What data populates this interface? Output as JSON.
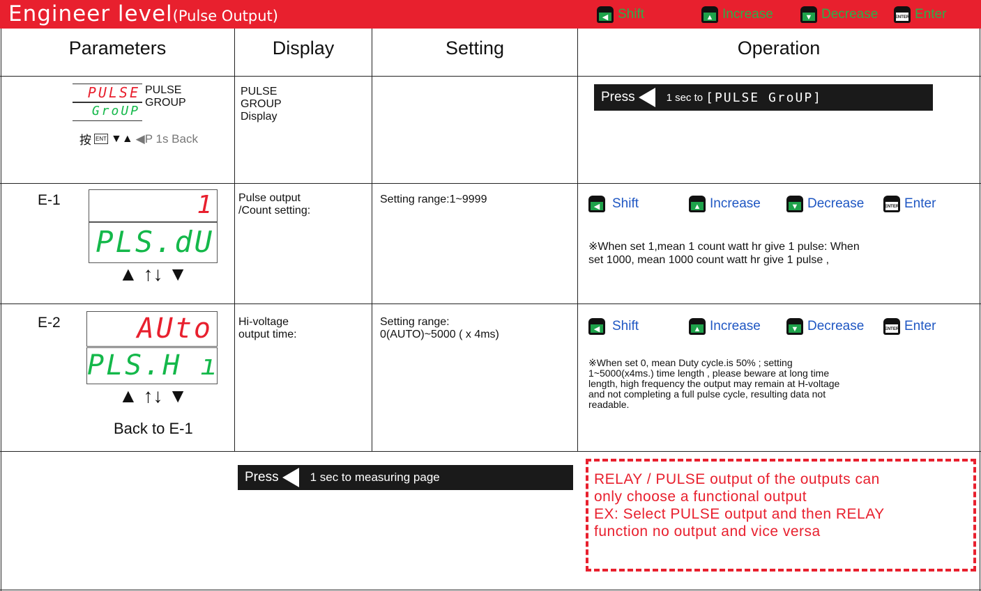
{
  "header": {
    "title": "Engineer level",
    "subtitle": "(Pulse Output)",
    "legend": [
      {
        "icon": "shift-key-icon",
        "label": "Shift",
        "glyph": "◀"
      },
      {
        "icon": "increase-key-icon",
        "label": "Increase",
        "glyph": "▲"
      },
      {
        "icon": "decrease-key-icon",
        "label": "Decrease",
        "glyph": "▼"
      },
      {
        "icon": "enter-key-icon",
        "label": "Enter",
        "glyph": "ENTER"
      }
    ]
  },
  "columns": [
    "Parameters",
    "Display",
    "Setting",
    "Operation"
  ],
  "row_group": {
    "lcd_top": "PULSE",
    "lcd_bottom": "GroUP",
    "caption_top": "PULSE",
    "caption_bottom": "GROUP",
    "nav_prefix": "按",
    "nav_ent": "ENT",
    "nav_arrows": "▼▲",
    "nav_back": "◀P 1s Back",
    "display": [
      "PULSE",
      "GROUP",
      "Display"
    ],
    "op_press": "Press",
    "op_text": "1 sec to",
    "op_code": "[PULSE GroUP]"
  },
  "row_e1": {
    "label": "E-1",
    "lcd_top": "1",
    "lcd_bottom": "PLS.dU",
    "arrows": "▲ ↑↓ ▼",
    "display": [
      "Pulse output",
      "/Count setting:"
    ],
    "setting": "Setting range:1~9999",
    "note": [
      "※When set 1,mean 1 count watt hr give 1 pulse: When",
      "set 1000, mean 1000 count watt hr give 1 pulse ,"
    ]
  },
  "row_e2": {
    "label": "E-2",
    "lcd_top": "AUto",
    "lcd_bottom": "PLS.H ı",
    "arrows": "▲ ↑↓ ▼",
    "back": "Back to E-1",
    "display": [
      "Hi-voltage",
      "output time:"
    ],
    "setting": [
      "Setting range:",
      "0(AUTO)~5000 ( x 4ms)"
    ],
    "note": [
      "※When set 0, mean Duty cycle.is  50% ; setting",
      "1~5000(x4ms.) time length , please beware at long time",
      "length, high frequency the output may remain at H-voltage",
      "and not completing a full pulse cycle, resulting data not",
      "readable."
    ]
  },
  "footer": {
    "press": "Press",
    "text": "1 sec to measuring page",
    "warning": [
      "RELAY /  PULSE output of the outputs can",
      "only choose a functional output",
      "EX: Select PULSE output and then RELAY",
      "function no output and vice versa"
    ]
  },
  "colors": {
    "header_red": "#e8202e",
    "lcd_green": "#14b84a",
    "key_green": "#2bb04a",
    "blue_text": "#1f57c3"
  }
}
